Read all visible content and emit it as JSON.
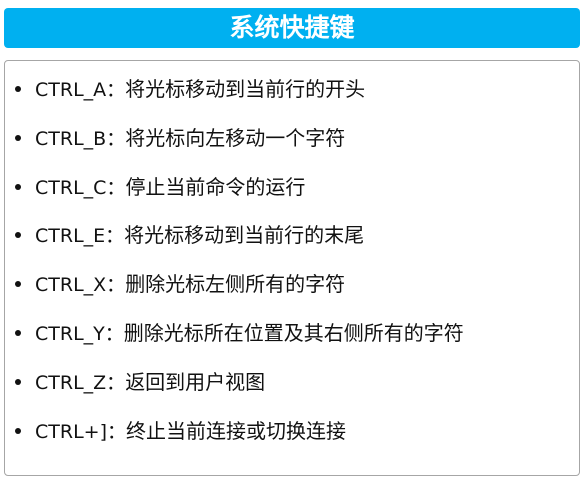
{
  "title": "系统快捷键",
  "items": [
    {
      "key": "CTRL_A：",
      "desc": "将光标移动到当前行的开头"
    },
    {
      "key": "CTRL_B：",
      "desc": "将光标向左移动一个字符"
    },
    {
      "key": "CTRL_C：",
      "desc": "停止当前命令的运行"
    },
    {
      "key": "CTRL_E：",
      "desc": "将光标移动到当前行的末尾"
    },
    {
      "key": "CTRL_X：",
      "desc": "删除光标左侧所有的字符"
    },
    {
      "key": "CTRL_Y：",
      "desc": "删除光标所在位置及其右侧所有的字符"
    },
    {
      "key": "CTRL_Z：",
      "desc": "返回到用户视图"
    },
    {
      "key": "CTRL+]：",
      "desc": "终止当前连接或切换连接"
    }
  ],
  "colors": {
    "header": "#00b0f0"
  }
}
